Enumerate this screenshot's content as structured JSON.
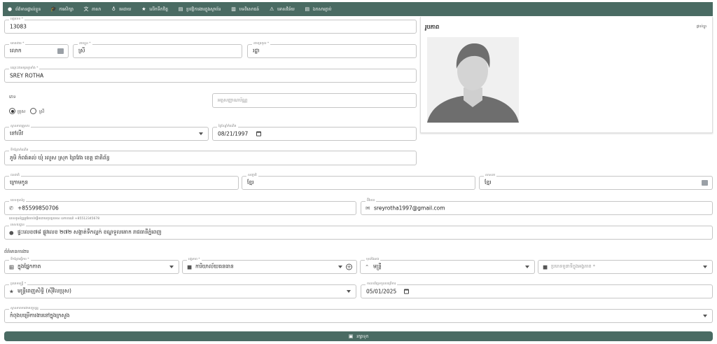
{
  "tabs": [
    {
      "icon": "●",
      "label": "ព័ត៌មានផ្ទាល់ខ្លួន"
    },
    {
      "icon": "🎓",
      "label": "ការសិក្សា"
    },
    {
      "icon": "文",
      "label": "ភាសា"
    },
    {
      "icon": "♁",
      "label": "មេដាយ"
    },
    {
      "icon": "★",
      "label": "លើកទឹកចិត្ត"
    },
    {
      "icon": "▤",
      "label": "ប្រវត្តិការងារក្នុងស្ថាប័ន"
    },
    {
      "icon": "▥",
      "label": "បទពិសោធន៍"
    },
    {
      "icon": "⚠",
      "label": "ទោសវិន័យ"
    },
    {
      "icon": "▤",
      "label": "ឯកសារភ្ជាប់"
    }
  ],
  "fields": {
    "id": {
      "label": "អត្តលេខ *",
      "value": "13083"
    },
    "title": {
      "label": "គោរមងារ *",
      "value": "លោក"
    },
    "first_name": {
      "label": "នាមខ្លួន *",
      "value": "ស្រី"
    },
    "last_name": {
      "label": "នាមត្រកូល *",
      "value": "រដ្ឋា"
    },
    "latin_name": {
      "label": "ឈ្មោះជាអក្សរឡាតាំង *",
      "value": "SREY ROTHA"
    },
    "gender_label": "ភេទ",
    "gender_male": "ប្រុស",
    "gender_female": "ស្រី",
    "id_card": {
      "placeholder": "អត្តសញ្ញាណប័ណ្ណ"
    },
    "marital": {
      "label": "ស្ថានភាពគ្រួសារ",
      "value": "នៅលីវ"
    },
    "dob": {
      "label": "ថ្ងៃខែឆ្នាំកំណើត",
      "value": "08/21/1997"
    },
    "birthplace": {
      "label": "ទីកន្លែងកំណើត",
      "value": "ភូមិ កំពង់គល់ ឃុំ រលួស ស្រុក ព្រៃវែង ខេត្ត ជាតិព័ន្ធ"
    },
    "ethnicity": {
      "label": "ជនជាតិ",
      "value": "ក្រោមកូន"
    },
    "nationality": {
      "label": "សញ្ជាតិ",
      "value": "ខ្មែរ"
    },
    "race": {
      "label": "សាសនា",
      "value": "ខ្មែរ"
    },
    "phone": {
      "label": "លេខទូរស័ព្ទ",
      "value": "+85599850706"
    },
    "phone_hint": "លេខទូរស័ព្ទត្រូវតែចាប់ផ្តើមដោយកូដប្រទេស ឧទាហរណ៍ +85512345678",
    "email": {
      "label": "អ៊ីមែល",
      "value": "sreyrotha1997@gmail.com"
    },
    "address": {
      "label": "អាសយដ្ឋាន",
      "value": "ផ្ទះលេខ៧៨ ផ្លូវលេខ ២៧២ សង្កាត់ទឹកល្អក់ ខណ្ឌទួលគោក រាជធានីភ្នំពេញ"
    },
    "work_section": "ព័ត៌មានការងារ",
    "department": {
      "label": "ទីកន្លែងធ្វើការ *",
      "value": "ក្នុងផ្នែកកាត"
    },
    "unit": {
      "label": "អង្គភាព *",
      "value": "ការិយាល័យធនធាន"
    },
    "position": {
      "label": "មុខតំណែង",
      "value": "មន្ត្រី"
    },
    "position_type": {
      "placeholder": "ប្រភេទតួនាទីក្នុងអង្គភាព *"
    },
    "staff_type": {
      "label": "ប្រភេទមន្ត្រី *",
      "value": "មន្ត្រីពេញសិទ្ធិ (ស៊ីវិលប្រុស)"
    },
    "start_date": {
      "label": "កាលបរិច្ឆេទចូលបម្រើការ",
      "value": "05/01/2025"
    },
    "work_status": {
      "label": "ស្ថានភាពការងារបច្ចុប្បន្ន",
      "value": "កំពុងបម្រើការងារនៅក្នុងក្រសួង"
    }
  },
  "photo": {
    "title": "រូបភាព",
    "action": "ផ្លាស់ប្តូរ"
  },
  "save_label": "រក្សាទុក",
  "colors": {
    "primary": "#4a6b63"
  }
}
